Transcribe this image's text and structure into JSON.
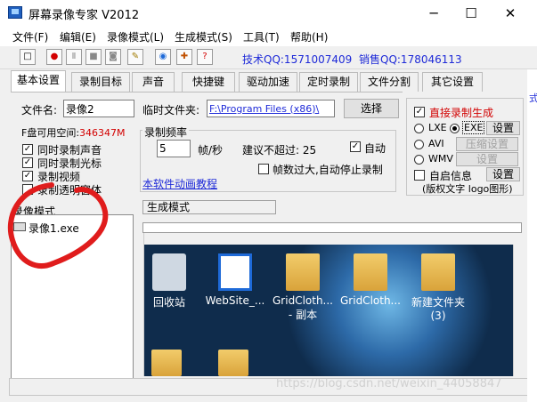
{
  "window": {
    "title": "屏幕录像专家 V2012",
    "min": "─",
    "max": "☐",
    "close": "✕"
  },
  "menu": [
    "文件(F)",
    "编辑(E)",
    "录像模式(L)",
    "生成模式(S)",
    "工具(T)",
    "帮助(H)"
  ],
  "toolbar": {
    "tech_qq": "技术QQ:1571007409",
    "sales_qq": "销售QQ:178046113"
  },
  "tabs": [
    "基本设置",
    "录制目标",
    "声音",
    "快捷键",
    "驱动加速",
    "定时录制",
    "文件分割",
    "其它设置"
  ],
  "basic": {
    "filename_label": "文件名:",
    "filename_value": "录像2",
    "tempdir_label": "临时文件夹:",
    "tempdir_value": "F:\\Program Files (x86)\\",
    "select_btn": "选择",
    "disk_free_label": "F盘可用空间:",
    "disk_free_value": "346347M",
    "checks": [
      "同时录制声音",
      "同时录制光标",
      "录制视频",
      "录制透明窗体"
    ],
    "freq_group": "录制频率",
    "fps_value": "5",
    "fps_unit": "帧/秒",
    "suggest": "建议不超过: 25",
    "auto": "自动",
    "auto_stop": "帧数过大,自动停止录制",
    "tutorial_link": "本软件动画教程"
  },
  "direct": {
    "title": "直接录制生成",
    "lxe": "LXE",
    "exe": "EXE",
    "avi": "AVI",
    "wmv": "WMV",
    "setup1": "设置",
    "compress": "压缩设置",
    "setup2": "设置",
    "custom_info": "自启信息",
    "setup3": "设置",
    "copyright": "(版权文字 logo图形)"
  },
  "lower": {
    "record_mode": "录像模式",
    "gen_mode": "生成模式",
    "file_item": "录像1.exe"
  },
  "desktop_icons": [
    "回收站",
    "WebSite_...",
    "GridCloth... - 副本",
    "GridCloth...",
    "新建文件夹 (3)"
  ],
  "watermark": "https://blog.csdn.net/weixin_44058847",
  "side_labels": {
    "a": "式",
    "b": "式"
  },
  "colors": {
    "accent": "#1e2ad8",
    "red": "#d20000",
    "desktop": "#0f2c4c"
  }
}
